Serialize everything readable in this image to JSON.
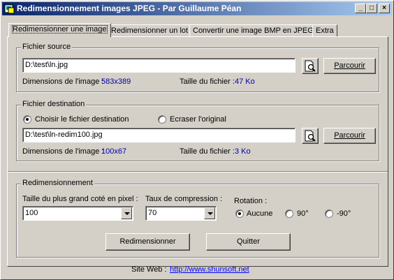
{
  "window": {
    "title": "Redimensionnement images JPEG - Par Guillaume Péan",
    "controls": {
      "minimize": "_",
      "maximize": "□",
      "close": "×"
    }
  },
  "tabs": [
    {
      "label": "Redimensionner une image",
      "active": true
    },
    {
      "label": "Redimensionner un lot",
      "active": false
    },
    {
      "label": "Convertir une image BMP en JPEG",
      "active": false
    },
    {
      "label": "Extra",
      "active": false
    }
  ],
  "source": {
    "legend": "Fichier source",
    "path": "D:\\test\\ln.jpg",
    "browse_label": "Parcourir",
    "dimensions_label": "Dimensions de l'image :",
    "dimensions_value": "583x389",
    "size_label": "Taille du fichier :",
    "size_value": "47 Ko"
  },
  "destination": {
    "legend": "Fichier destination",
    "radio_choose": "Choisir le fichier destination",
    "radio_overwrite": "Ecraser l'original",
    "path": "D:\\test\\ln-redim100.jpg",
    "browse_label": "Parcourir",
    "dimensions_label": "Dimensions de l'image :",
    "dimensions_value": "100x67",
    "size_label": "Taille du fichier :",
    "size_value": "3 Ko"
  },
  "resize": {
    "legend": "Redimensionnement",
    "largest_side_label": "Taille du plus grand coté en pixel :",
    "largest_side_value": "100",
    "compression_label": "Taux de compression :",
    "compression_value": "70",
    "rotation_label": "Rotation :",
    "rotation_options": [
      "Aucune",
      "90°",
      "-90°"
    ],
    "rotation_selected": "Aucune",
    "resize_button": "Redimensionner",
    "quit_button": "Quitter"
  },
  "footer": {
    "site_label": "Site Web :",
    "site_url": "http://www.shunsoft.net"
  },
  "colors": {
    "title_gradient_start": "#0a246a",
    "title_gradient_end": "#a6caf0",
    "info_value": "#0000aa",
    "link": "#0000ff"
  },
  "icons": {
    "app": "app-icon",
    "browse": "magnifier-document-icon"
  }
}
